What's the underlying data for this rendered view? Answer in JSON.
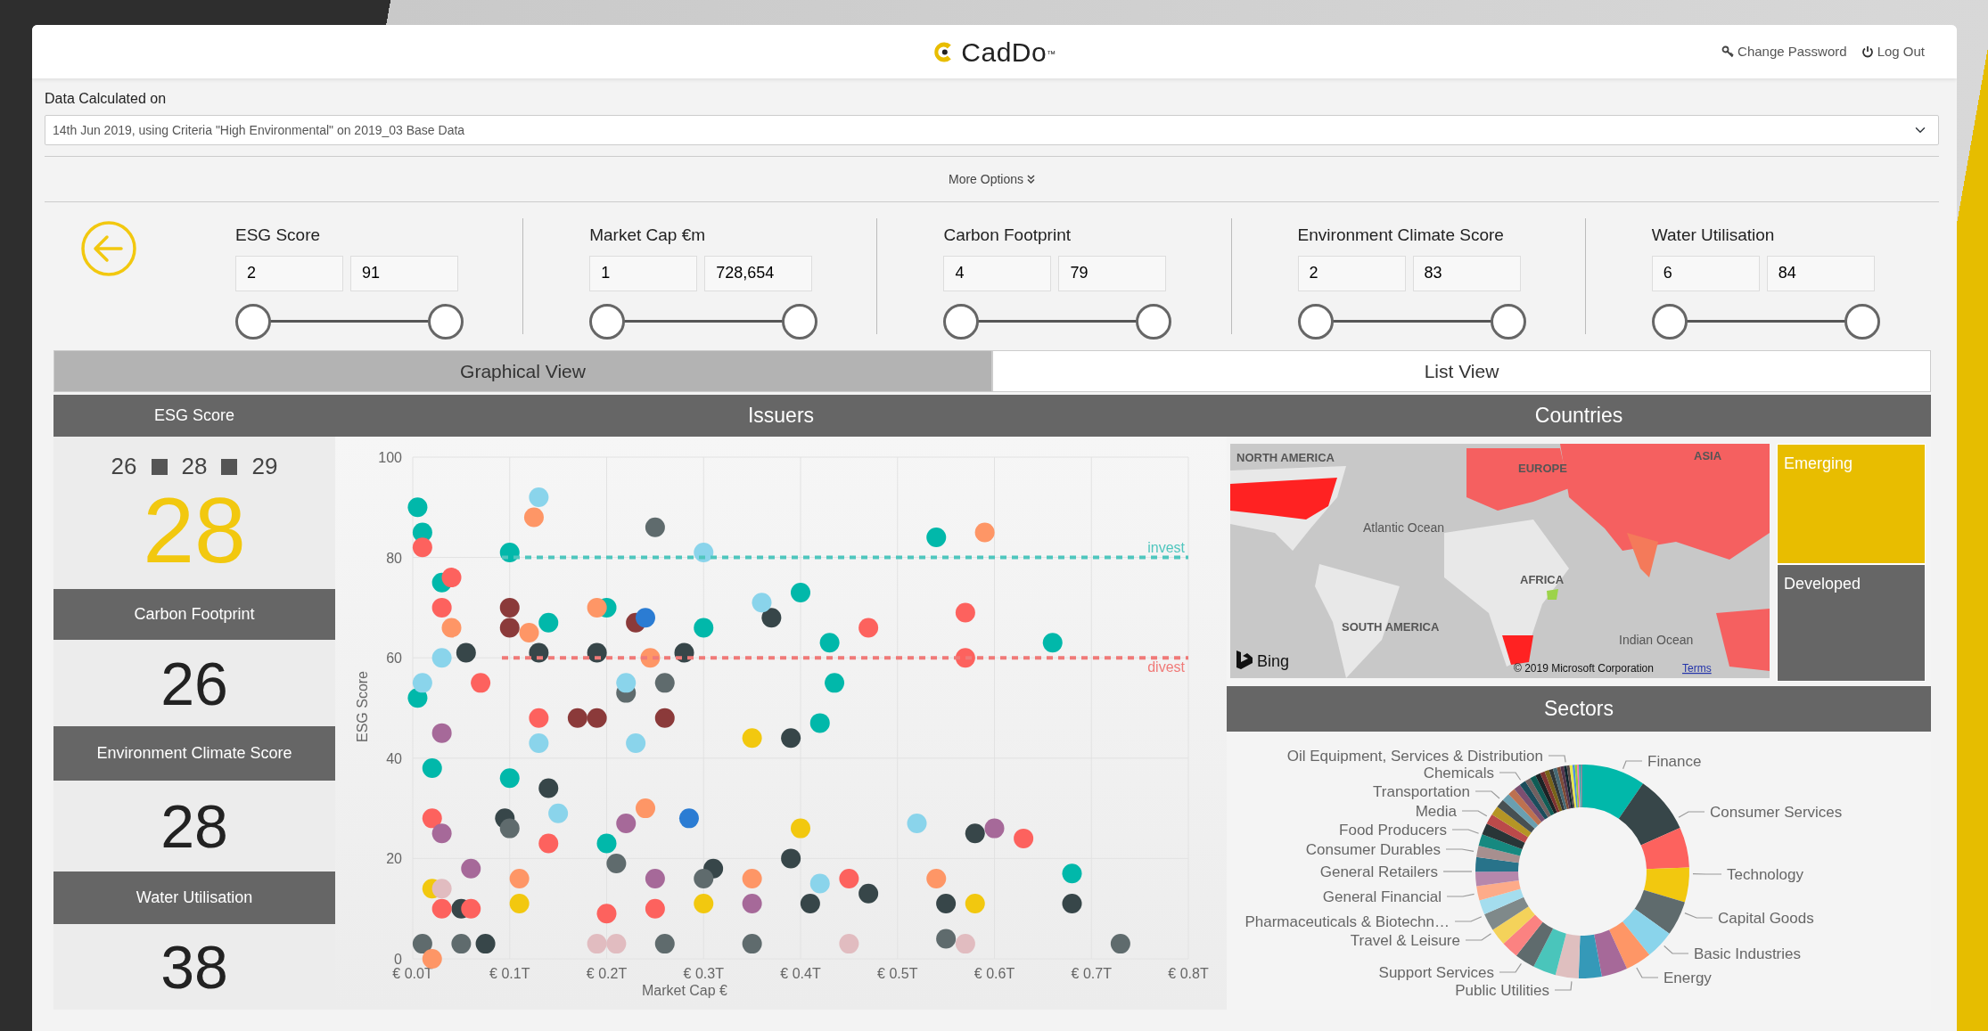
{
  "header": {
    "logo": "CadDo$^{™}$",
    "links": [
      {
        "kind": "password",
        "label": "Change Password"
      },
      {
        "kind": "logout",
        "label": "Log Out"
      }
    ]
  },
  "data_calculated": {
    "label": "Data Calculated on",
    "value": "14th Jun 2019, using Criteria \"High Environmental\" on 2019_03 Base Data"
  },
  "more_options": "More Options",
  "filters": [
    {
      "label": "ESG Score",
      "min": "2",
      "max": "91",
      "thumbs": [
        {
          "level": 0
        },
        {
          "level": 1
        }
      ]
    },
    {
      "label": "Market Cap €m",
      "min": "1",
      "max": "728,654",
      "thumbs": [
        {
          "level": 0
        },
        {
          "level": 1
        }
      ]
    },
    {
      "label": "Carbon Footprint",
      "min": "4",
      "max": "79",
      "thumbs": [
        {
          "level": 0
        },
        {
          "level": 1
        }
      ]
    },
    {
      "label": "Environment Climate Score",
      "min": "2",
      "max": "83",
      "thumbs": [
        {
          "level": 0
        },
        {
          "level": 1
        }
      ]
    },
    {
      "label": "Water Utilisation",
      "min": "6",
      "max": "84",
      "thumbs": [
        {
          "level": 0
        },
        {
          "level": 1
        }
      ]
    }
  ],
  "tabs": [
    {
      "label": "Graphical View",
      "selected": true
    },
    {
      "label": "List View",
      "selected": false
    }
  ],
  "scores": [
    {
      "kind": "headline",
      "label": "ESG Score",
      "range": [
        "26",
        "28",
        "29"
      ],
      "value": "28"
    },
    {
      "kind": "metric",
      "label": "Carbon Footprint",
      "value": "26"
    },
    {
      "kind": "metric",
      "label": "Environment Climate Score",
      "value": "28"
    },
    {
      "kind": "metric",
      "label": "Water Utilisation",
      "value": "38"
    }
  ],
  "issuers": {
    "title": "Issuers",
    "chart_data": {
      "type": "scatter",
      "xlabel": "Market Cap €",
      "ylabel": "ESG Score",
      "xlim": [
        0,
        0.8
      ],
      "ylim": [
        0,
        100
      ],
      "xticks": [
        {
          "value": 0,
          "label": "€ 0.0T"
        },
        {
          "value": 0.1,
          "label": "€ 0.1T"
        },
        {
          "value": 0.2,
          "label": "€ 0.2T"
        },
        {
          "value": 0.3,
          "label": "€ 0.3T"
        },
        {
          "value": 0.4,
          "label": "€ 0.4T"
        },
        {
          "value": 0.5,
          "label": "€ 0.5T"
        },
        {
          "value": 0.6,
          "label": "€ 0.6T"
        },
        {
          "value": 0.7,
          "label": "€ 0.7T"
        },
        {
          "value": 0.8,
          "label": "€ 0.8T"
        }
      ],
      "yticks": [
        0,
        20,
        40,
        60,
        80,
        100
      ],
      "grid": true,
      "ref_lines": [
        {
          "axis": "y",
          "value": 80,
          "label": "invest",
          "color": "#4fc6be"
        },
        {
          "axis": "y",
          "value": 60,
          "label": "divest",
          "color": "#f07a78"
        }
      ],
      "series": [
        {
          "color": "#01b8aa",
          "x": [
            0.005,
            0.01,
            0.03,
            0.1,
            0.14,
            0.2,
            0.3,
            0.4,
            0.43,
            0.435,
            0.42,
            0.54,
            0.66,
            0.68,
            0.2,
            0.1,
            0.02,
            0.005
          ],
          "values": [
            90,
            85,
            75,
            81,
            67,
            70,
            66,
            73,
            63,
            55,
            47,
            84,
            63,
            17,
            23,
            36,
            38,
            52
          ]
        },
        {
          "color": "#374649",
          "x": [
            0.13,
            0.19,
            0.28,
            0.37,
            0.39,
            0.14,
            0.095,
            0.31,
            0.39,
            0.47,
            0.55,
            0.68,
            0.58,
            0.41,
            0.075,
            0.05,
            0.055
          ],
          "values": [
            61,
            61,
            61,
            68,
            44,
            34,
            28,
            18,
            20,
            13,
            11,
            11,
            25,
            11,
            3,
            10,
            61
          ]
        },
        {
          "color": "#fd625e",
          "x": [
            0.01,
            0.04,
            0.03,
            0.07,
            0.13,
            0.47,
            0.57,
            0.57,
            0.14,
            0.63,
            0.45,
            0.03,
            0.06,
            0.2,
            0.25,
            0.02
          ],
          "values": [
            82,
            76,
            70,
            55,
            48,
            66,
            69,
            60,
            23,
            24,
            16,
            10,
            10,
            9,
            10,
            28
          ]
        },
        {
          "color": "#5f6b6d",
          "x": [
            0.25,
            0.26,
            0.22,
            0.1,
            0.21,
            0.3,
            0.35,
            0.55,
            0.73,
            0.01,
            0.05,
            0.26
          ],
          "values": [
            86,
            55,
            53,
            26,
            19,
            16,
            3,
            4,
            3,
            3,
            3,
            3
          ]
        },
        {
          "color": "#8ad4eb",
          "x": [
            0.13,
            0.3,
            0.36,
            0.22,
            0.23,
            0.13,
            0.15,
            0.52,
            0.42,
            0.03,
            0.01
          ],
          "values": [
            92,
            81,
            71,
            55,
            43,
            43,
            29,
            27,
            15,
            60,
            55
          ]
        },
        {
          "color": "#fe9666",
          "x": [
            0.125,
            0.19,
            0.12,
            0.245,
            0.59,
            0.24,
            0.35,
            0.54,
            0.04,
            0.11,
            0.02
          ],
          "values": [
            88,
            70,
            65,
            60,
            85,
            30,
            16,
            16,
            66,
            16,
            0
          ]
        },
        {
          "color": "#f2c80f",
          "x": [
            0.35,
            0.4,
            0.58,
            0.3,
            0.11,
            0.02
          ],
          "values": [
            44,
            26,
            11,
            11,
            11,
            14
          ]
        },
        {
          "color": "#a66999",
          "x": [
            0.03,
            0.22,
            0.25,
            0.35,
            0.6,
            0.03,
            0.06
          ],
          "values": [
            45,
            27,
            16,
            11,
            26,
            25,
            18
          ]
        },
        {
          "color": "#8b3a3a",
          "x": [
            0.17,
            0.19,
            0.26,
            0.1,
            0.1,
            0.23
          ],
          "values": [
            48,
            48,
            48,
            70,
            66,
            67
          ]
        },
        {
          "color": "#e1bcc0",
          "x": [
            0.19,
            0.21,
            0.45,
            0.57,
            0.03
          ],
          "values": [
            3,
            3,
            3,
            3,
            14
          ]
        },
        {
          "color": "#2b7cd3",
          "x": [
            0.24,
            0.285
          ],
          "values": [
            68,
            28
          ]
        }
      ]
    }
  },
  "countries": {
    "title": "Countries",
    "map": {
      "labels": [
        "NORTH AMERICA",
        "EUROPE",
        "ASIA",
        "Atlantic Ocean",
        "AFRICA",
        "SOUTH AMERICA",
        "Indian Ocean"
      ],
      "brand": "Bing",
      "attribution": "© 2019 Microsoft Corporation",
      "terms_link": "Terms"
    },
    "segments": [
      {
        "label": "Emerging",
        "color": "#e8bd00"
      },
      {
        "label": "Developed",
        "color": "#666666"
      }
    ]
  },
  "sectors": {
    "title": "Sectors",
    "labels_left": [
      "Oil Equipment, Services & Distribution",
      "Chemicals",
      "Transportation",
      "Media",
      "Food Producers",
      "Consumer Durables",
      "General Retailers",
      "General Financial",
      "Pharmaceuticals & Biotechn…",
      "Travel & Leisure",
      "Support Services",
      "Public Utilities"
    ],
    "labels_right": [
      "Finance",
      "Consumer Services",
      "Technology",
      "Capital Goods",
      "Basic Industries",
      "Energy"
    ]
  }
}
